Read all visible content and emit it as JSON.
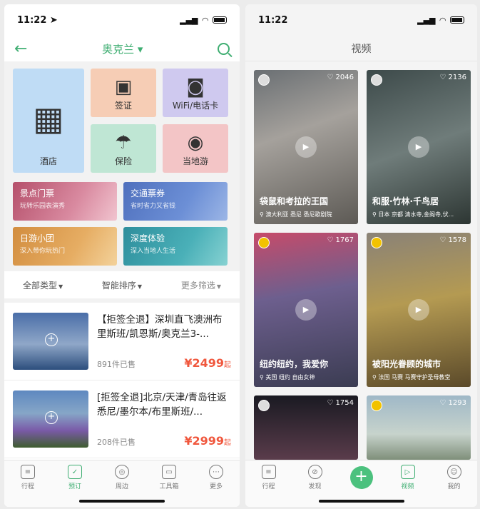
{
  "left": {
    "status_time": "11:22 ➤",
    "nav": {
      "title": "奥克兰 ▾"
    },
    "services": {
      "hotel": "酒店",
      "visa": "签证",
      "wifi": "WiFi/电话卡",
      "insurance": "保险",
      "local": "当地游"
    },
    "banners": [
      {
        "title": "景点门票",
        "sub": "玩转乐园表演秀"
      },
      {
        "title": "交通票券",
        "sub": "省时省力又省钱"
      },
      {
        "title": "日游小团",
        "sub": "深入带你玩热门"
      },
      {
        "title": "深度体验",
        "sub": "深入当地人生活"
      }
    ],
    "filters": {
      "type": "全部类型",
      "sort": "智能排序",
      "more": "更多筛选"
    },
    "products": [
      {
        "name": "【拒签全退】深圳直飞澳洲布里斯班/凯恩斯/奥克兰3-...",
        "sold": "891件已售",
        "price": "¥2499",
        "unit": "起"
      },
      {
        "name": "[拒签全退]北京/天津/青岛往返悉尼/墨尔本/布里斯班/...",
        "sold": "208件已售",
        "price": "¥2999",
        "unit": "起"
      }
    ],
    "tabs": [
      {
        "label": "行程",
        "icon": "calendar-icon"
      },
      {
        "label": "预订",
        "icon": "check-box-icon"
      },
      {
        "label": "周边",
        "icon": "target-icon"
      },
      {
        "label": "工具箱",
        "icon": "toolbox-icon"
      },
      {
        "label": "更多",
        "icon": "more-icon"
      }
    ]
  },
  "right": {
    "status_time": "11:22",
    "nav": {
      "title": "视频"
    },
    "videos": [
      {
        "likes": "♡ 2046",
        "title": "袋鼠和考拉的王国",
        "location": "澳大利亚 悉尼 悉尼歌剧院"
      },
      {
        "likes": "♡ 2136",
        "title": "和服·竹林·千鸟居",
        "location": "日本 京都 清水寺,金阁寺,伏..."
      },
      {
        "likes": "♡ 1767",
        "title": "纽约纽约，我爱你",
        "location": "美国 纽约 自由女神"
      },
      {
        "likes": "♡ 1578",
        "title": "被阳光眷顾的城市",
        "location": "法国 马赛 马赛守护圣母教堂"
      },
      {
        "likes": "♡ 1754"
      },
      {
        "likes": "♡ 1293"
      }
    ],
    "tabs": [
      {
        "label": "行程",
        "icon": "calendar-icon"
      },
      {
        "label": "发现",
        "icon": "compass-icon"
      },
      {
        "label": "+",
        "icon": "plus-icon"
      },
      {
        "label": "视频",
        "icon": "video-icon"
      },
      {
        "label": "我的",
        "icon": "smiley-icon"
      }
    ]
  }
}
